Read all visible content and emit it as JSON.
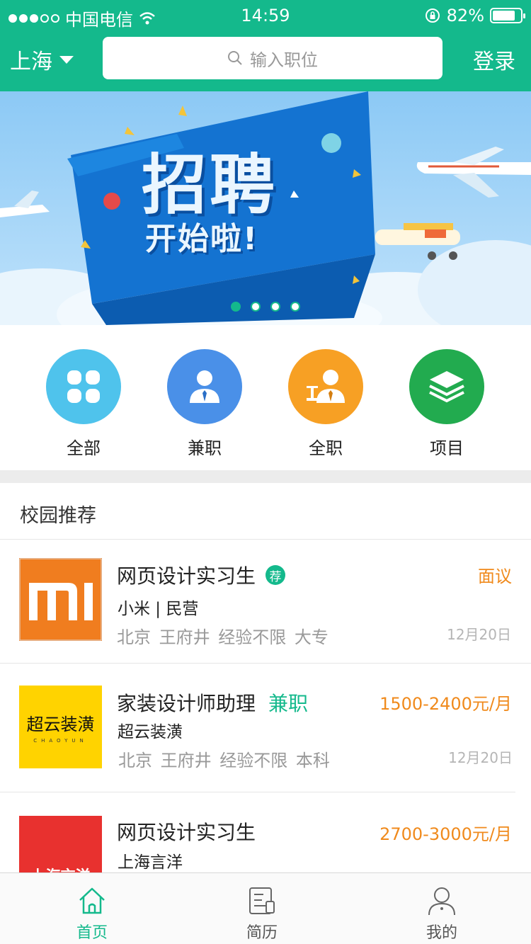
{
  "status_bar": {
    "carrier": "中国电信",
    "time": "14:59",
    "battery": "82%",
    "battery_level": 0.82
  },
  "nav": {
    "city": "上海",
    "search_placeholder": "输入职位",
    "login": "登录"
  },
  "banner": {
    "title": "招聘",
    "subtitle": "开始啦!",
    "pages": 4,
    "active_page": 1
  },
  "categories": [
    {
      "label": "全部",
      "color": "#4fc3ec",
      "icon": "grid-icon"
    },
    {
      "label": "兼职",
      "color": "#4a90e8",
      "icon": "person-icon"
    },
    {
      "label": "全职",
      "color": "#f7a024",
      "icon": "person-desk-icon"
    },
    {
      "label": "项目",
      "color": "#22ab4f",
      "icon": "layers-icon"
    }
  ],
  "section": {
    "title": "校园推荐"
  },
  "jobs": [
    {
      "title": "网页设计实习生",
      "badge": "荐",
      "company": "小米 | 民营",
      "meta": "北京 王府井 经验不限 大专",
      "salary": "面议",
      "date": "12月20日",
      "logo_text": "mi",
      "logo_bg": "#f07d1f"
    },
    {
      "title": "家装设计师助理",
      "tag": "兼职",
      "company": "超云装潢",
      "meta": "北京 王府井 经验不限 本科",
      "salary": "1500-2400元/月",
      "date": "12月20日",
      "logo_text": "超云装潢",
      "logo_sub": "CHAOYUN",
      "logo_bg": "#ffd300"
    },
    {
      "title": "网页设计实习生",
      "company": "上海言洋",
      "salary": "2700-3000元/月",
      "logo_text": "上海言洋",
      "logo_bg": "#e8312f"
    }
  ],
  "tabbar": [
    {
      "label": "首页",
      "icon": "home-icon",
      "active": true
    },
    {
      "label": "简历",
      "icon": "resume-icon",
      "active": false
    },
    {
      "label": "我的",
      "icon": "profile-icon",
      "active": false
    }
  ],
  "colors": {
    "brand": "#14b98c",
    "salary": "#f08a1c"
  }
}
